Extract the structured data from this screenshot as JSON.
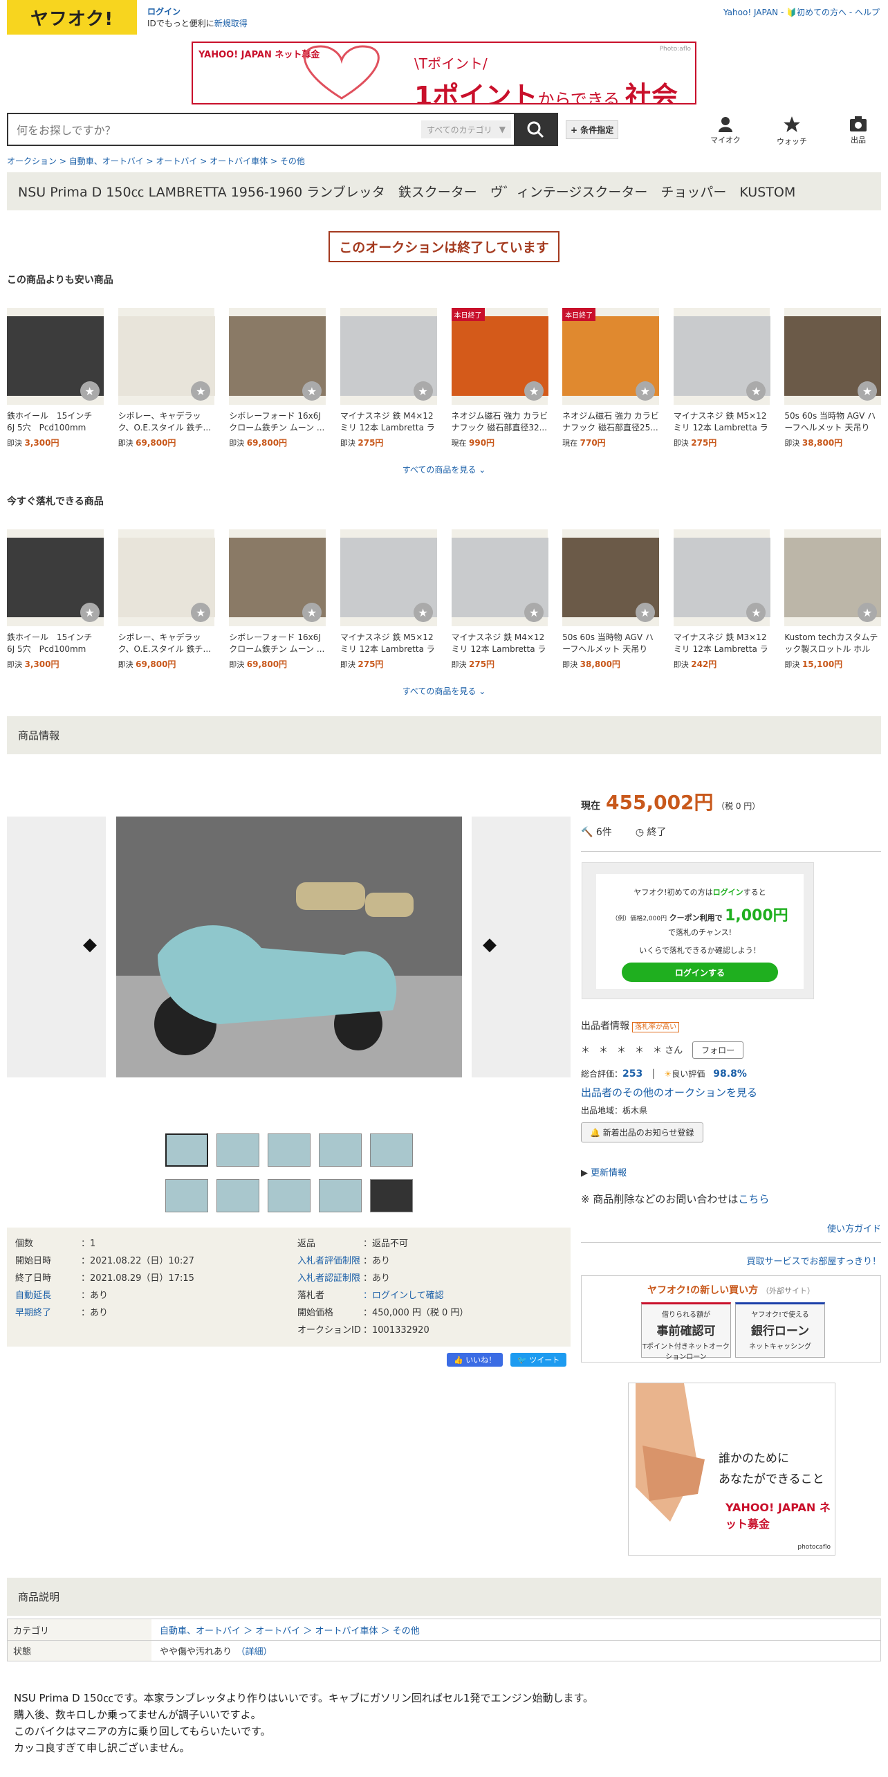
{
  "header": {
    "logo": "ヤフオク!",
    "login": "ログイン",
    "login_sub_1": "IDでもっと便利に",
    "login_sub_2": "新規取得",
    "links": "Yahoo! JAPAN -  🔰初めての方へ -  ヘルプ"
  },
  "banner": {
    "brand": "YAHOO! JAPAN ネット募金",
    "line1": "\\Tポイント/",
    "line2a": "1ポイント",
    "line2b": "からできる",
    "line2c": "社会貢献",
    "credit": "Photo:aflo"
  },
  "search": {
    "placeholder": "何をお探しですか？",
    "category": "すべてのカテゴリ",
    "conditions": "+ 条件指定"
  },
  "nav": {
    "mypage": "マイオク",
    "watch": "ウォッチ",
    "sell": "出品"
  },
  "breadcrumb": [
    "オークション",
    "自動車、オートバイ",
    "オートバイ",
    "オートバイ車体",
    "その他"
  ],
  "title": "NSU Prima D 150㏄ LAMBRETTA 1956-1960 ランブレッタ　鉄スクーター　ヴ゛ィンテージスクーター　チョッパー　KUSTOM",
  "ended_notice": "このオークションは終了しています",
  "cheaper": {
    "heading": "この商品よりも安い商品",
    "see_all": "すべての商品を見る",
    "items": [
      {
        "name": "鉄ホイール　15インチ　6J 5穴　Pcd100mm オ...",
        "type": "即決",
        "price": "3,300円",
        "tag": "",
        "color": "#3c3c3c"
      },
      {
        "name": "シボレー、キャデラック、O.E.スタイル 鉄チ...",
        "type": "即決",
        "price": "69,800円",
        "tag": "",
        "color": "#e8e4da"
      },
      {
        "name": "シボレーフォード 16x6J クローム鉄チン ムーン ...",
        "type": "即決",
        "price": "69,800円",
        "tag": "",
        "color": "#8a7a66"
      },
      {
        "name": "マイナスネジ 鉄 M4×12ミリ 12本 Lambretta ラン...",
        "type": "即決",
        "price": "275円",
        "tag": "",
        "color": "#c9cbcd"
      },
      {
        "name": "ネオジム磁石 強力 カラビナフック 磁石部直径32...",
        "type": "現在",
        "price": "990円",
        "tag": "本日終了",
        "color": "#d45a1a"
      },
      {
        "name": "ネオジム磁石 強力 カラビナフック 磁石部直径25...",
        "type": "現在",
        "price": "770円",
        "tag": "本日終了",
        "color": "#e0892f"
      },
      {
        "name": "マイナスネジ 鉄 M5×12ミリ 12本 Lambretta ラン...",
        "type": "即決",
        "price": "275円",
        "tag": "",
        "color": "#c9cbcd"
      },
      {
        "name": "50s 60s 当時物 AGV ハーフヘルメット 天吊り M...",
        "type": "即決",
        "price": "38,800円",
        "tag": "",
        "color": "#6b5a48"
      }
    ]
  },
  "buynow": {
    "heading": "今すぐ落札できる商品",
    "see_all": "すべての商品を見る",
    "items": [
      {
        "name": "鉄ホイール　15インチ　6J 5穴　Pcd100mm オ...",
        "type": "即決",
        "price": "3,300円",
        "color": "#3c3c3c"
      },
      {
        "name": "シボレー、キャデラック、O.E.スタイル 鉄チ...",
        "type": "即決",
        "price": "69,800円",
        "color": "#e8e4da"
      },
      {
        "name": "シボレーフォード 16x6J クローム鉄チン ムーン ...",
        "type": "即決",
        "price": "69,800円",
        "color": "#8a7a66"
      },
      {
        "name": "マイナスネジ 鉄 M5×12ミリ 12本 Lambretta ラン...",
        "type": "即決",
        "price": "275円",
        "color": "#c9cbcd"
      },
      {
        "name": "マイナスネジ 鉄 M4×12ミリ 12本 Lambretta ラン...",
        "type": "即決",
        "price": "275円",
        "color": "#c9cbcd"
      },
      {
        "name": "50s 60s 当時物 AGV ハーフヘルメット 天吊り M...",
        "type": "即決",
        "price": "38,800円",
        "color": "#6b5a48"
      },
      {
        "name": "マイナスネジ 鉄 M3×12ミリ 12本 Lambretta ラン...",
        "type": "即決",
        "price": "242円",
        "color": "#c9cbcd"
      },
      {
        "name": "Kustom techカスタムテック製スロットル ホルダ...",
        "type": "即決",
        "price": "15,100円",
        "color": "#bcb6a8"
      }
    ]
  },
  "product_section": "商品情報",
  "price": {
    "label": "現在",
    "value": "455,002円",
    "tax": "（税 0 円）",
    "bids": "6件",
    "status": "終了"
  },
  "login_box": {
    "l1a": "ヤフオク!初めての方は",
    "l1b": "ログイン",
    "l1c": "すると",
    "ex": "（例）価格2,000円",
    "coupon": "クーポン利用で",
    "amount": "1,000円",
    "chance": "で落札のチャンス!",
    "check": "いくらで落札できるか確認しよう！",
    "btn": "ログインする"
  },
  "seller": {
    "heading": "出品者情報",
    "badge": "落札率が高い",
    "name": "＊　＊　＊　＊　＊",
    "san": "さん",
    "follow": "フォロー",
    "rating_label": "総合評価：",
    "rating": "253",
    "good_label": "良い評価",
    "good": "98.8%",
    "other": "出品者のその他のオークションを見る",
    "region": "出品地域：栃木県",
    "notify": "新着出品のお知らせ登録",
    "update": "更新情報",
    "inquiry_a": "※ 商品削除などのお問い合わせは",
    "inquiry_b": "こちら",
    "guide": "使い方ガイド",
    "buyservice": "買取サービスでお部屋すっきり！"
  },
  "new_buy": {
    "heading": "ヤフオク!の新しい買い方",
    "ext": "（外部サイト）",
    "b1a": "借りられる額が",
    "b1b": "事前確認可",
    "b1c": "Tポイント付きネットオークションローン",
    "b2a": "ヤフオク!で使える",
    "b2b": "銀行ローン",
    "b2c": "ネットキャッシング"
  },
  "ad2": {
    "line1": "誰かのために",
    "line2": "あなたができること",
    "brand": "YAHOO! JAPAN ネット募金",
    "credit": "photocaflo"
  },
  "details": {
    "left": [
      [
        "個数",
        "：1"
      ],
      [
        "開始日時",
        "：2021.08.22（日）10:27"
      ],
      [
        "終了日時",
        "：2021.08.29（日）17:15"
      ],
      [
        "自動延長",
        "：あり"
      ],
      [
        "早期終了",
        "：あり"
      ]
    ],
    "right": [
      [
        "返品",
        "：返品不可"
      ],
      [
        "入札者評価制限",
        "：あり"
      ],
      [
        "入札者認証制限",
        "：あり"
      ],
      [
        "落札者",
        "：ログインして確認"
      ],
      [
        "開始価格",
        "：450,000 円（税 0 円）"
      ],
      [
        "オークションID",
        "：1001332920"
      ]
    ]
  },
  "social": {
    "like": "👍 いいね！",
    "tweet": "🐦 ツイート"
  },
  "description_section": "商品説明",
  "desc_table": {
    "cat_label": "カテゴリ",
    "cat_value": "自動車、オートバイ ＞ オートバイ ＞ オートバイ車体 ＞ その他",
    "cond_label": "状態",
    "cond_value": "やや傷や汚れあり",
    "cond_detail": "（詳細）"
  },
  "description": [
    "NSU Prima D 150㏄です。本家ランブレッタより作りはいいです。キャブにガソリン回ればセル1発でエンジン始動します。",
    "購入後、数キロしか乗ってませんが調子いいですよ。",
    "このバイクはマニアの方に乗り回してもらいたいです。",
    "カッコ良すぎて申し訳ございません。"
  ]
}
